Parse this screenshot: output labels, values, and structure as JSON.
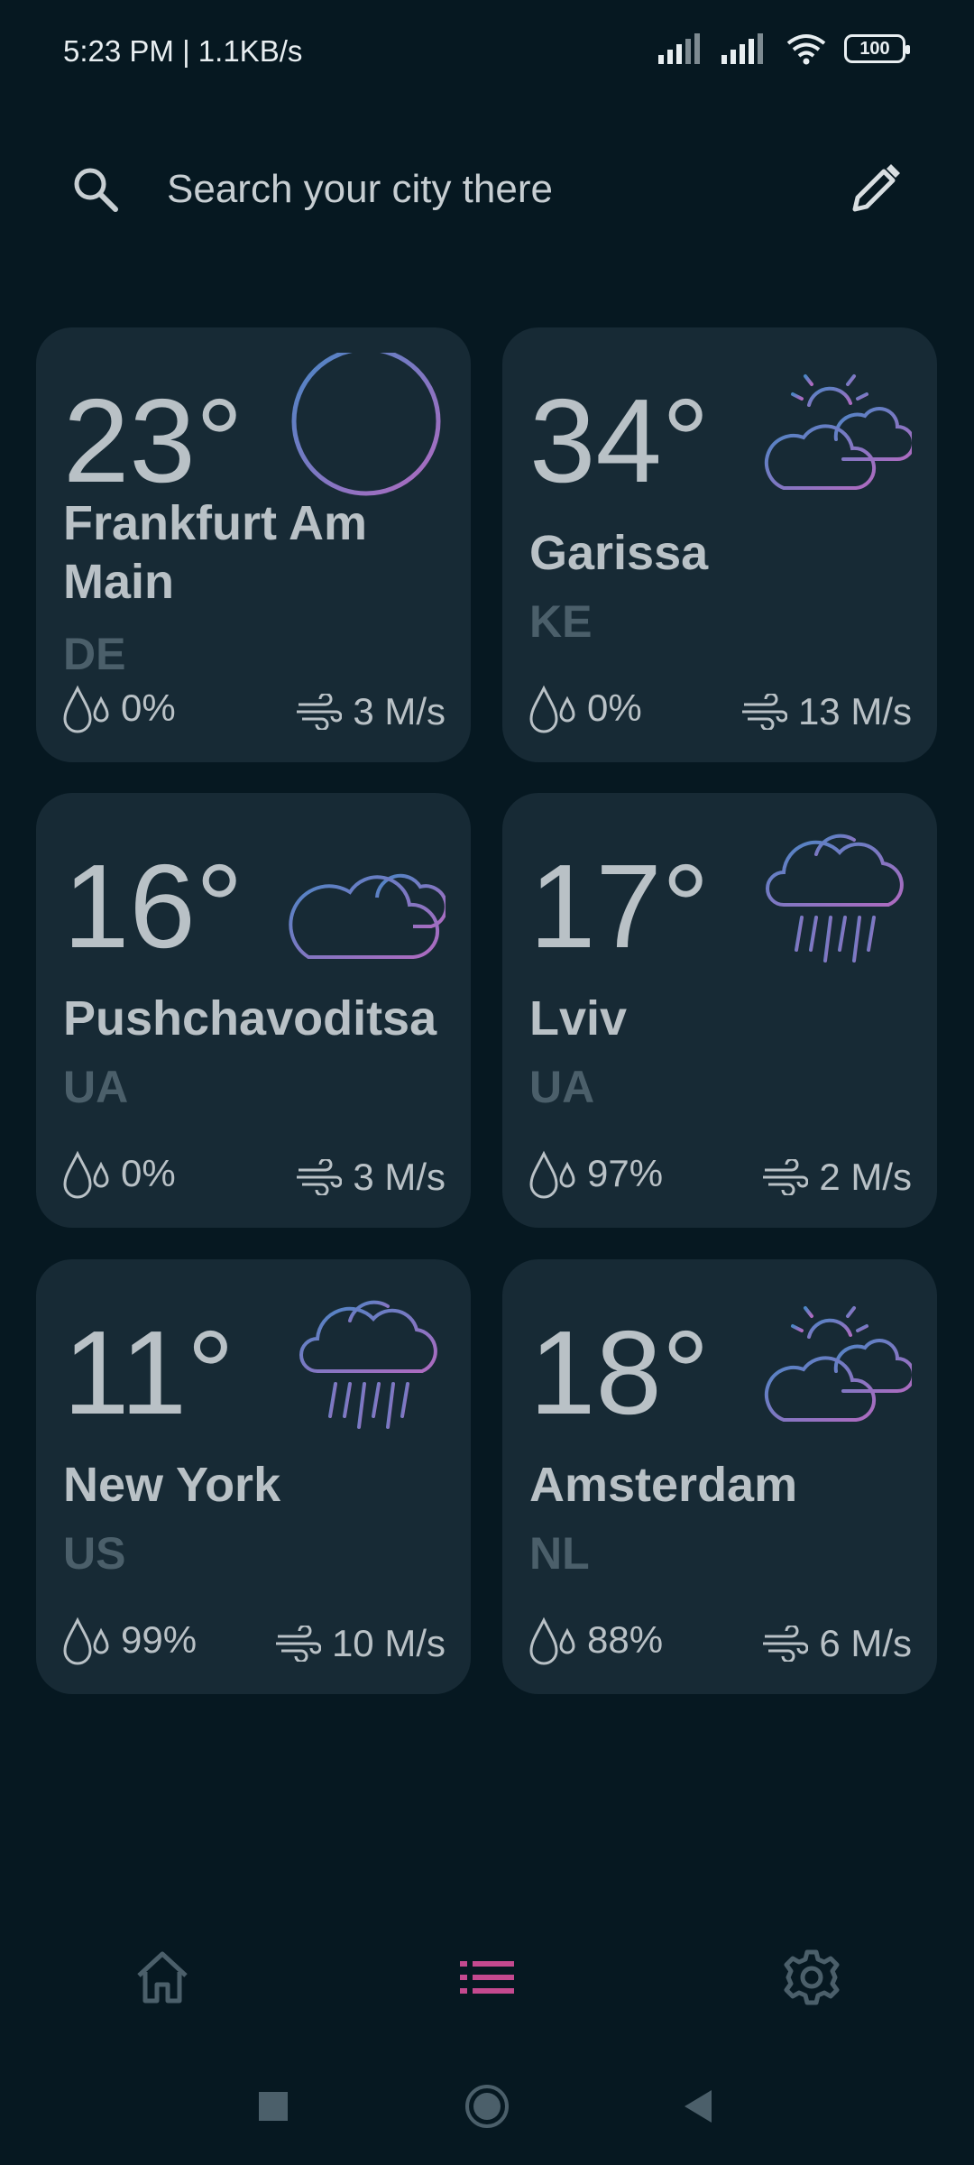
{
  "status": {
    "time": "5:23 PM | 1.1KB/s",
    "battery": "100"
  },
  "search": {
    "placeholder": "Search your city there"
  },
  "colors": {
    "background": "#061821",
    "card": "#172a35",
    "accent": "#c4498f",
    "muted": "#4b5f6a",
    "gradient_start": "#4a86c5",
    "gradient_end": "#b06ac0"
  },
  "cards": [
    {
      "temp": "23°",
      "city": "Frankfurt Am Main",
      "country": "DE",
      "humidity": "0%",
      "wind": "3 M/s",
      "icon": "clear-sky-icon"
    },
    {
      "temp": "34°",
      "city": "Garissa",
      "country": "KE",
      "humidity": "0%",
      "wind": "13 M/s",
      "icon": "partly-cloudy-icon"
    },
    {
      "temp": "16°",
      "city": "Pushchavoditsa",
      "country": "UA",
      "humidity": "0%",
      "wind": "3 M/s",
      "icon": "cloudy-icon"
    },
    {
      "temp": "17°",
      "city": "Lviv",
      "country": "UA",
      "humidity": "97%",
      "wind": "2 M/s",
      "icon": "rain-icon"
    },
    {
      "temp": "11°",
      "city": "New York",
      "country": "US",
      "humidity": "99%",
      "wind": "10 M/s",
      "icon": "rain-icon"
    },
    {
      "temp": "18°",
      "city": "Amsterdam",
      "country": "NL",
      "humidity": "88%",
      "wind": "6 M/s",
      "icon": "partly-cloudy-icon"
    }
  ],
  "nav": {
    "items": [
      "home-icon",
      "list-icon",
      "settings-icon"
    ],
    "active": "list-icon"
  }
}
